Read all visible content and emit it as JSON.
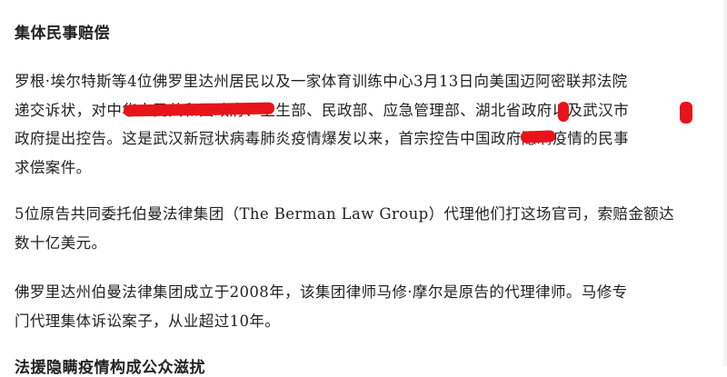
{
  "article": {
    "heading": "集体民事赔偿",
    "paragraph1": {
      "line1": "罗根·埃尔特斯等4位佛罗里达州居民以及一家体育训练中心3月13日向美国迈阿密联邦法院",
      "line2": "递交诉状，对中华人民共和国政府、卫生部、民政部、应急管理部、湖北省政府以及武汉市",
      "line3": "政府提出控告。这是武汉新冠状病毒肺炎疫情爆发以来，首宗控告中国政府隐瞒疫情的民事",
      "line4": "求偿案件。"
    },
    "paragraph2": {
      "line1": "5位原告共同委托伯曼法律集团（The Berman Law Group）代理他们打这场官司，索赔金额达",
      "line2": "数十亿美元。"
    },
    "paragraph3": {
      "line1": "佛罗里达州伯曼法律集团成立于2008年，该集团律师马修·摩尔是原告的代理律师。马修专",
      "line2": "门代理集体诉讼案子，从业超过10年。"
    },
    "next_heading_partial": "法援隐瞒疫情构成公众滋扰"
  },
  "colors": {
    "redaction": "#e8131b",
    "text": "#222222",
    "background": "#ffffff"
  }
}
